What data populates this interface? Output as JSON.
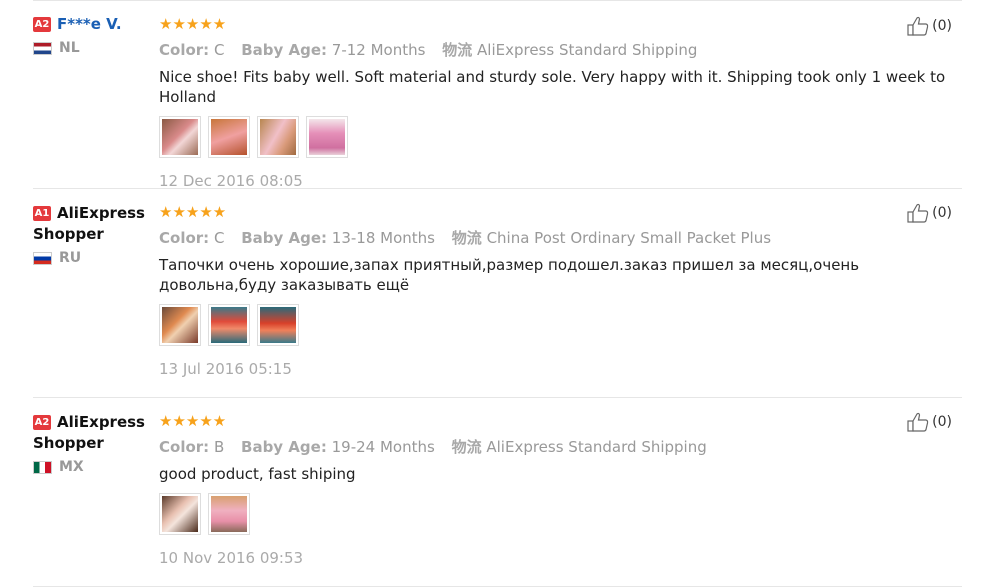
{
  "reviews": [
    {
      "level": "A2",
      "name": "F***e V.",
      "country": "NL",
      "stars": "★★★★★",
      "color_label": "Color:",
      "color_value": "C",
      "age_label": "Baby Age:",
      "age_value": "7-12 Months",
      "ship_label": "物流",
      "ship_value": "AliExpress Standard Shipping",
      "text": "Nice shoe! Fits baby well. Soft material and sturdy sole. Very happy with it. Shipping took only 1 week to Holland",
      "date": "12 Dec 2016 08:05",
      "likes": "(0)"
    },
    {
      "level": "A1",
      "name": "AliExpress Shopper",
      "country": "RU",
      "stars": "★★★★★",
      "color_label": "Color:",
      "color_value": "C",
      "age_label": "Baby Age:",
      "age_value": "13-18 Months",
      "ship_label": "物流",
      "ship_value": "China Post Ordinary Small Packet Plus",
      "text": "Тапочки очень хорошие,запах приятный,размер подошел.заказ пришел за месяц,очень довольна,буду заказывать ещё",
      "date": "13 Jul 2016 05:15",
      "likes": "(0)"
    },
    {
      "level": "A2",
      "name": "AliExpress Shopper",
      "country": "MX",
      "stars": "★★★★★",
      "color_label": "Color:",
      "color_value": "B",
      "age_label": "Baby Age:",
      "age_value": "19-24 Months",
      "ship_label": "物流",
      "ship_value": "AliExpress Standard Shipping",
      "text": "good product, fast shiping",
      "date": "10 Nov 2016 09:53",
      "likes": "(0)"
    }
  ],
  "colors": {
    "level_badge": "#e4393c",
    "star": "#f7a21b",
    "link": "#1a5fb4"
  }
}
